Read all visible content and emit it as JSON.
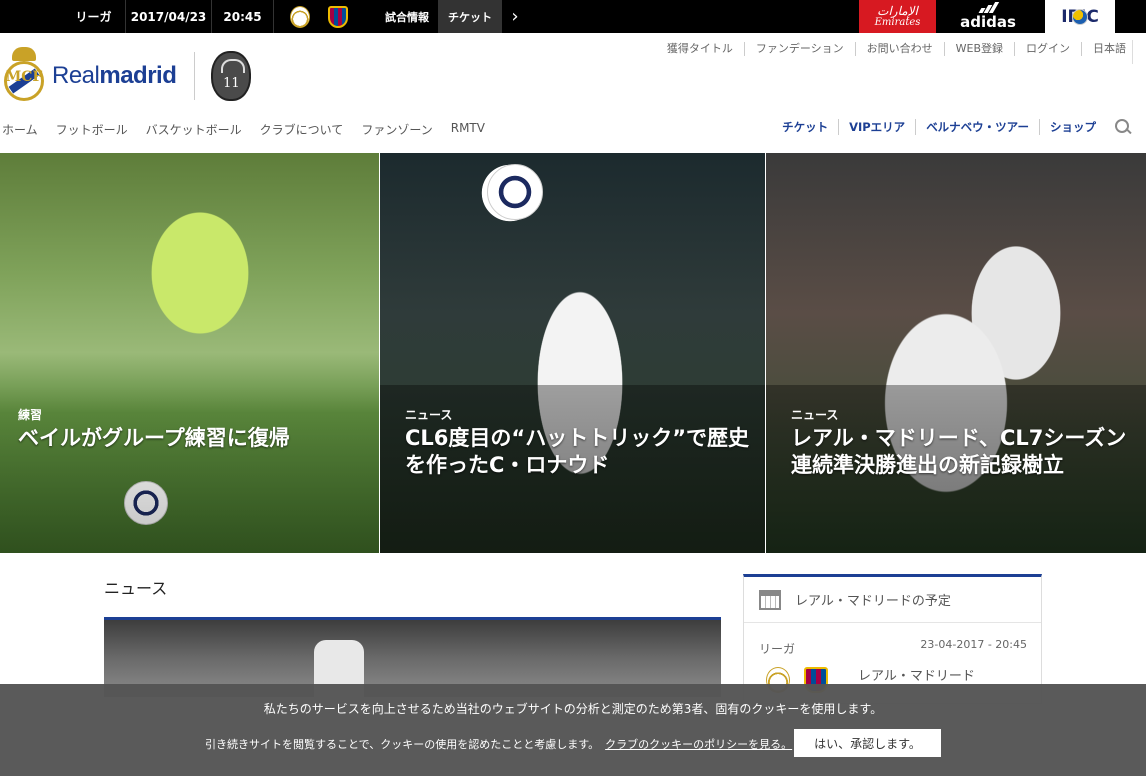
{
  "topbar": {
    "competition": "リーガ",
    "date": "2017/04/23",
    "time": "20:45",
    "home_crest": "real-madrid-crest",
    "away_crest": "barcelona-crest",
    "match_info": "試合情報",
    "ticket": "チケット",
    "next_icon": "chevron-right-icon",
    "sponsors": {
      "emirates": "Emirates",
      "adidas": "adidas",
      "ipic": "IPIC"
    }
  },
  "header": {
    "brand_light": "Real",
    "brand_bold": "madrid",
    "badge_text": "11",
    "util_links": [
      "獲得タイトル",
      "ファンデーション",
      "お問い合わせ",
      "WEB登録",
      "ログイン",
      "日本語"
    ],
    "main_nav": [
      "ホーム",
      "フットボール",
      "バスケットボール",
      "クラブについて",
      "ファンゾーン",
      "RMTV"
    ],
    "right_nav": [
      "チケット",
      "VIPエリア",
      "ベルナベウ・ツアー",
      "ショップ"
    ]
  },
  "hero": [
    {
      "category": "練習",
      "title": "ベイルがグループ練習に復帰"
    },
    {
      "category": "ニュース",
      "title": "CL6度目の“ハットトリック”で歴史を作ったC・ロナウド"
    },
    {
      "category": "ニュース",
      "title": "レアル・マドリード、CL7シーズン連続準決勝進出の新記録樹立"
    }
  ],
  "news": {
    "section_title": "ニュース"
  },
  "schedule": {
    "title": "レアル・マドリードの予定",
    "competition": "リーガ",
    "datetime": "23-04-2017 - 20:45",
    "team": "レアル・マドリード"
  },
  "cookie": {
    "line1": "私たちのサービスを向上させるため当社のウェブサイトの分析と測定のため第3者、固有のクッキーを使用します。",
    "line2": "引き続きサイトを閲覧することで、クッキーの使用を認めたことと考慮します。",
    "policy_link": "クラブのクッキーのポリシーを見る。",
    "accept_button": "はい、承認します。"
  },
  "colors": {
    "brand_blue": "#1c3f94",
    "gold": "#c9a227",
    "emirates_red": "#d71921"
  }
}
